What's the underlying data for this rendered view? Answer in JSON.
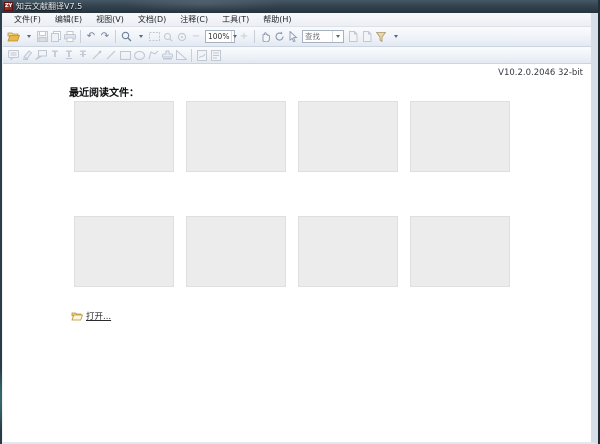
{
  "window": {
    "title": "知云文献翻译V7.5",
    "app_icon_text": "ZY"
  },
  "menu": {
    "items": [
      {
        "label": "文件(F)"
      },
      {
        "label": "编辑(E)"
      },
      {
        "label": "视图(V)"
      },
      {
        "label": "文档(D)"
      },
      {
        "label": "注释(C)"
      },
      {
        "label": "工具(T)"
      },
      {
        "label": "帮助(H)"
      }
    ]
  },
  "toolbar": {
    "zoom_value": "100%",
    "find_value": "查找",
    "icons": {
      "rotate_left": "↶",
      "rotate_right": "↷",
      "minus": "−",
      "plus": "+",
      "typewriter": "T",
      "underline_text": "T",
      "strikeout_text": "T"
    }
  },
  "content": {
    "version": "V10.2.0.2046 32-bit",
    "recent_heading": "最近阅读文件：",
    "open_label": "打开...",
    "accent_colors": {
      "folder_yellow": "#e8b84b",
      "titlebar_dark": "#33434f",
      "thumbnail_gray": "#ececec"
    }
  }
}
